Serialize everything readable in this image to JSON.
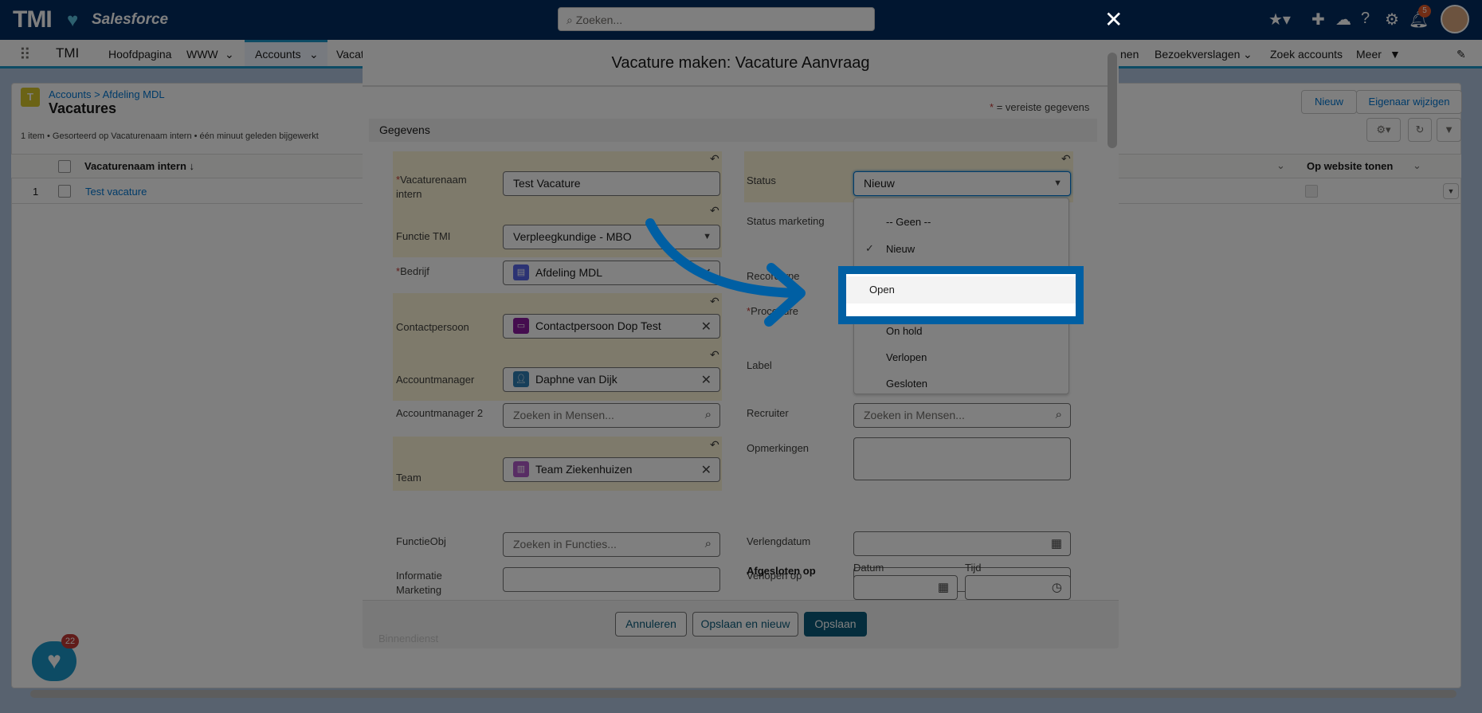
{
  "topbar": {
    "logo": "TMI",
    "logo_sub": "Salesforce",
    "search_placeholder": "Zoeken...",
    "notification_count": "5",
    "help": "?"
  },
  "nav": {
    "app": "TMI",
    "items": [
      "Hoofdpagina",
      "WWW",
      "Accounts",
      "Vacat",
      "nen",
      "Bezoekverslagen",
      "Zoek accounts",
      "Meer"
    ]
  },
  "list": {
    "breadcrumb": "Accounts > Afdeling MDL",
    "title": "Vacatures",
    "info": "1 item • Gesorteerd op Vacaturenaam intern • één minuut geleden bijgewerkt",
    "buttons": {
      "new": "Nieuw",
      "change_owner": "Eigenaar wijzigen"
    },
    "columns": [
      "Vacaturenaam intern ↓",
      "Op website tonen"
    ],
    "rows": [
      {
        "num": "1",
        "name": "Test vacature"
      }
    ]
  },
  "modal": {
    "title": "Vacature maken: Vacature Aanvraag",
    "required_note": "= vereiste gegevens",
    "section": "Gegevens",
    "left": {
      "vacaturenaam_label": "Vacaturenaam intern",
      "vacaturenaam_value": "Test Vacature",
      "functie_label": "Functie TMI",
      "functie_value": "Verpleegkundige - MBO",
      "bedrijf_label": "Bedrijf",
      "bedrijf_value": "Afdeling MDL",
      "contact_label": "Contactpersoon",
      "contact_value": "Contactpersoon Dop Test",
      "am_label": "Accountmanager",
      "am_value": "Daphne van Dijk",
      "am2_label": "Accountmanager 2",
      "am2_placeholder": "Zoeken in Mensen...",
      "team_label": "Team",
      "team_value": "Team Ziekenhuizen",
      "functieobj_label": "FunctieObj",
      "functieobj_placeholder": "Zoeken in Functies...",
      "info_label": "Informatie Marketing"
    },
    "right": {
      "status_label": "Status",
      "status_value": "Nieuw",
      "status_marketing_label": "Status marketing",
      "recordtype_label": "Recordtype",
      "procedure_label": "Procedure",
      "label_label": "Label",
      "recruiter_label": "Recruiter",
      "recruiter_placeholder": "Zoeken in Mensen...",
      "opmerkingen_label": "Opmerkingen",
      "verlengdatum_label": "Verlengdatum",
      "verlopen_label": "Verlopen op",
      "afgesloten_label": "Afgesloten op",
      "datum_label": "Datum",
      "tijd_label": "Tijd"
    },
    "status_options": [
      "-- Geen --",
      "Nieuw",
      "Open",
      "On hold",
      "Verlopen",
      "Gesloten"
    ],
    "selected_option": "Nieuw",
    "highlighted_option": "Open",
    "peek_text": "Binnendienst",
    "footer": {
      "cancel": "Annuleren",
      "save_new": "Opslaan en nieuw",
      "save": "Opslaan"
    }
  },
  "utility_badge": "22",
  "colors": {
    "highlight": "#005fa3",
    "brand": "#032d60",
    "save_button": "#0b5b7a"
  }
}
